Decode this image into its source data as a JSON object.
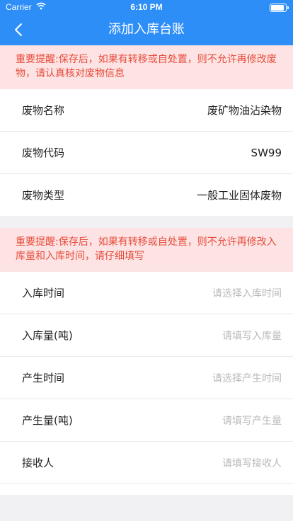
{
  "status_bar": {
    "carrier": "Carrier",
    "time": "6:10 PM",
    "battery_level": 1.0
  },
  "nav": {
    "title": "添加入库台账"
  },
  "notice_1": "重要提醒:保存后，如果有转移或自处置，则不允许再修改废物，请认真核对废物信息",
  "waste_info": [
    {
      "label": "废物名称",
      "value": "废矿物油沾染物"
    },
    {
      "label": "废物代码",
      "value": "SW99"
    },
    {
      "label": "废物类型",
      "value": "一般工业固体废物"
    }
  ],
  "notice_2": "重要提醒:保存后，如果有转移或自处置，则不允许再修改入库量和入库时间，请仔细填写",
  "form": [
    {
      "label": "入库时间",
      "placeholder": "请选择入库时间"
    },
    {
      "label": "入库量(吨)",
      "placeholder": "请填写入库量"
    },
    {
      "label": "产生时间",
      "placeholder": "请选择产生时间"
    },
    {
      "label": "产生量(吨)",
      "placeholder": "请填写产生量"
    },
    {
      "label": "接收人",
      "placeholder": "请填写接收人"
    }
  ]
}
